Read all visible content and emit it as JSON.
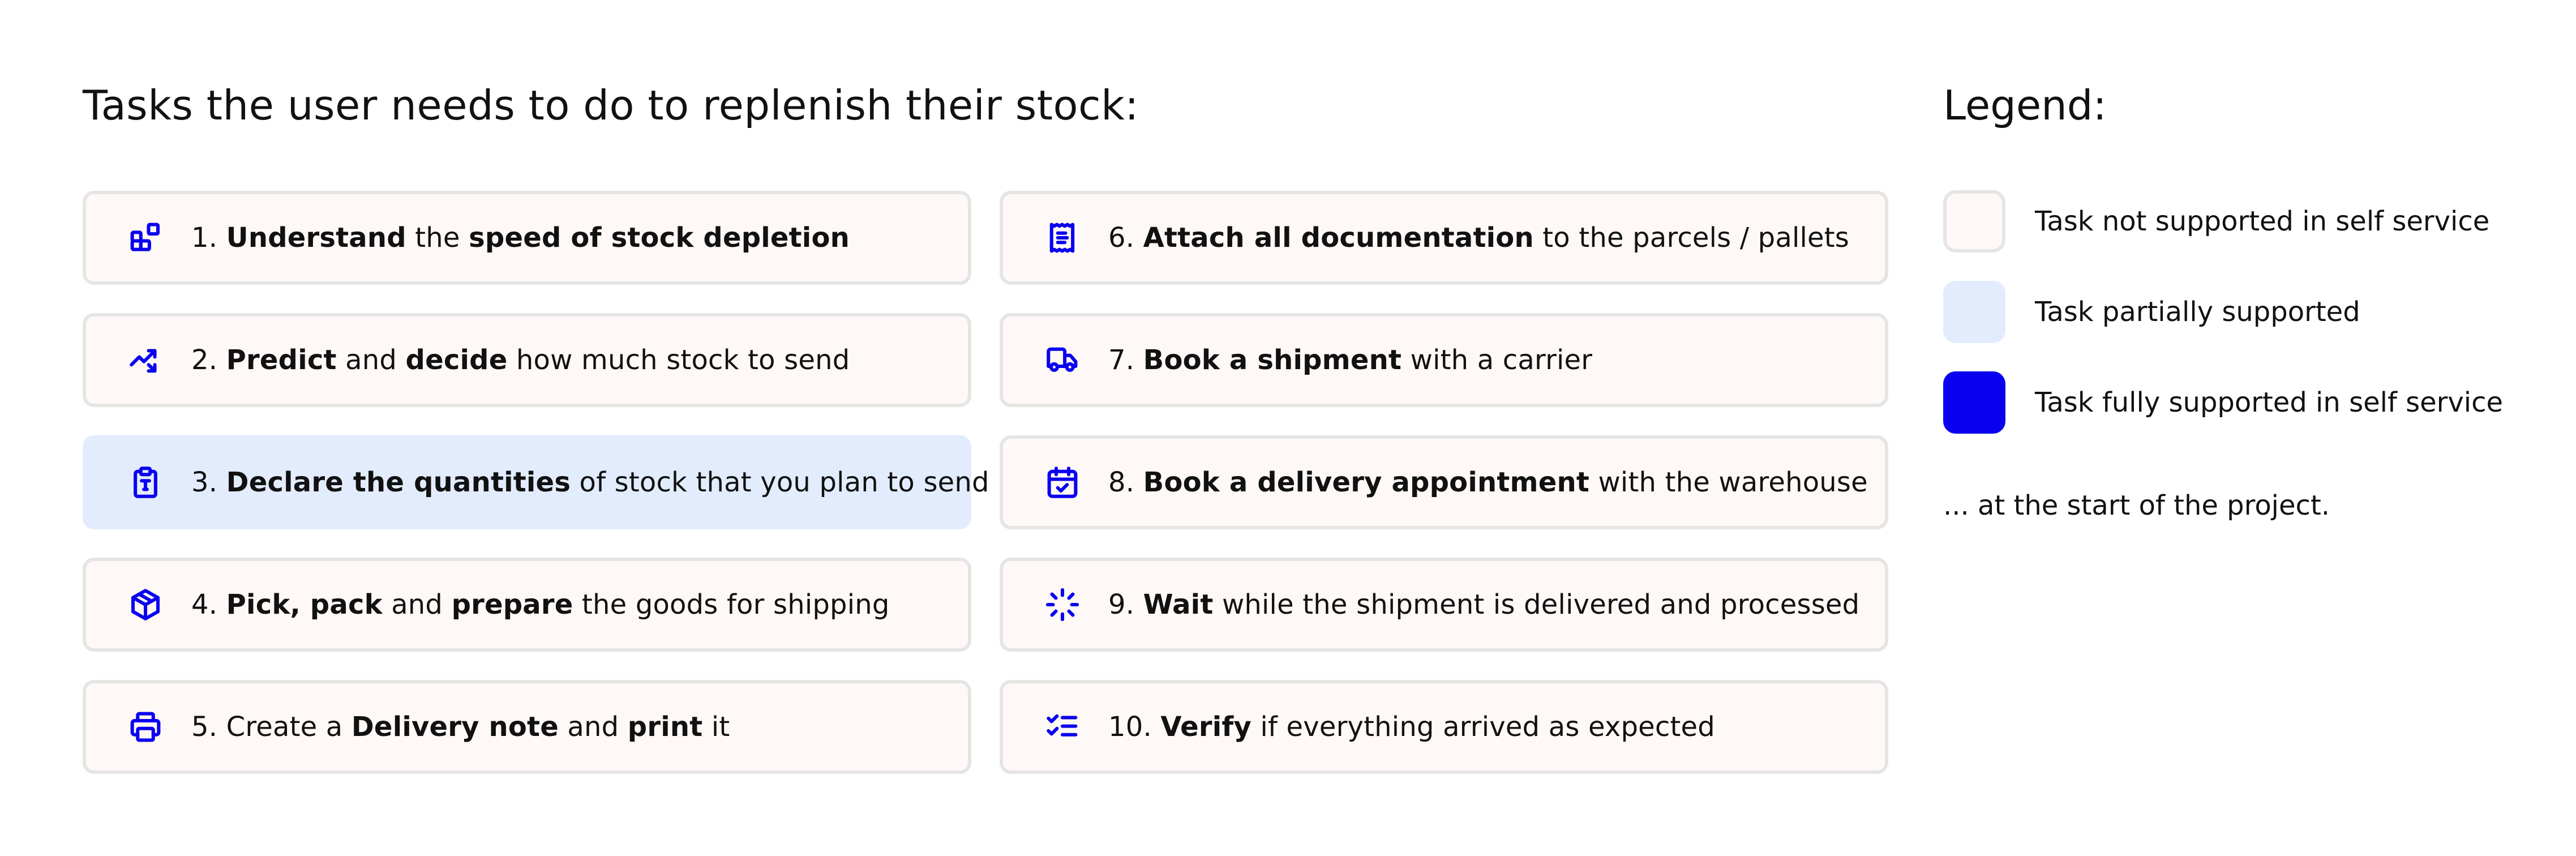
{
  "title": "Tasks the user needs to do to replenish their stock:",
  "colors": {
    "accent": "#0a00f0",
    "not_supported_bg": "#fef8f6",
    "not_supported_border": "#e6e5e5",
    "partial_bg": "#e2ecfd",
    "full_bg": "#0a00f0"
  },
  "tasks": [
    {
      "number": 1,
      "icon": "blocks-icon",
      "status": "not-supported",
      "segments": [
        {
          "t": "1. ",
          "b": false
        },
        {
          "t": "Understand",
          "b": true
        },
        {
          "t": " the ",
          "b": false
        },
        {
          "t": "speed of stock depletion",
          "b": true
        }
      ]
    },
    {
      "number": 2,
      "icon": "trend-split-icon",
      "status": "not-supported",
      "segments": [
        {
          "t": "2. ",
          "b": false
        },
        {
          "t": "Predict",
          "b": true
        },
        {
          "t": " and ",
          "b": false
        },
        {
          "t": "decide",
          "b": true
        },
        {
          "t": " how much stock to send",
          "b": false
        }
      ]
    },
    {
      "number": 3,
      "icon": "clipboard-text-icon",
      "status": "partial",
      "segments": [
        {
          "t": "3. ",
          "b": false
        },
        {
          "t": "Declare the quantities",
          "b": true
        },
        {
          "t": " of stock that you plan to send",
          "b": false
        }
      ]
    },
    {
      "number": 4,
      "icon": "package-icon",
      "status": "not-supported",
      "segments": [
        {
          "t": "4. ",
          "b": false
        },
        {
          "t": "Pick, pack",
          "b": true
        },
        {
          "t": " and ",
          "b": false
        },
        {
          "t": "prepare",
          "b": true
        },
        {
          "t": " the goods for shipping",
          "b": false
        }
      ]
    },
    {
      "number": 5,
      "icon": "printer-icon",
      "status": "not-supported",
      "segments": [
        {
          "t": "5. Create a ",
          "b": false
        },
        {
          "t": "Delivery note",
          "b": true
        },
        {
          "t": " and ",
          "b": false
        },
        {
          "t": "print",
          "b": true
        },
        {
          "t": " it",
          "b": false
        }
      ]
    },
    {
      "number": 6,
      "icon": "receipt-icon",
      "status": "not-supported",
      "segments": [
        {
          "t": "6. ",
          "b": false
        },
        {
          "t": "Attach all documentation",
          "b": true
        },
        {
          "t": " to the parcels / pallets",
          "b": false
        }
      ]
    },
    {
      "number": 7,
      "icon": "truck-icon",
      "status": "not-supported",
      "segments": [
        {
          "t": "7. ",
          "b": false
        },
        {
          "t": "Book a shipment",
          "b": true
        },
        {
          "t": " with a carrier",
          "b": false
        }
      ]
    },
    {
      "number": 8,
      "icon": "calendar-check-icon",
      "status": "not-supported",
      "segments": [
        {
          "t": "8. ",
          "b": false
        },
        {
          "t": "Book a delivery appointment",
          "b": true
        },
        {
          "t": " with the warehouse",
          "b": false
        }
      ]
    },
    {
      "number": 9,
      "icon": "loader-icon",
      "status": "not-supported",
      "segments": [
        {
          "t": "9. ",
          "b": false
        },
        {
          "t": "Wait",
          "b": true
        },
        {
          "t": " while the shipment is delivered and processed",
          "b": false
        }
      ]
    },
    {
      "number": 10,
      "icon": "checklist-icon",
      "status": "not-supported",
      "segments": [
        {
          "t": "10. ",
          "b": false
        },
        {
          "t": "Verify",
          "b": true
        },
        {
          "t": " if everything arrived as expected",
          "b": false
        }
      ]
    }
  ],
  "legend": {
    "title": "Legend:",
    "items": [
      {
        "status": "not-supported",
        "label": "Task not supported in self service"
      },
      {
        "status": "partial",
        "label": "Task partially supported"
      },
      {
        "status": "full",
        "label": "Task fully supported in self service"
      }
    ],
    "note": "... at the start of the project."
  }
}
